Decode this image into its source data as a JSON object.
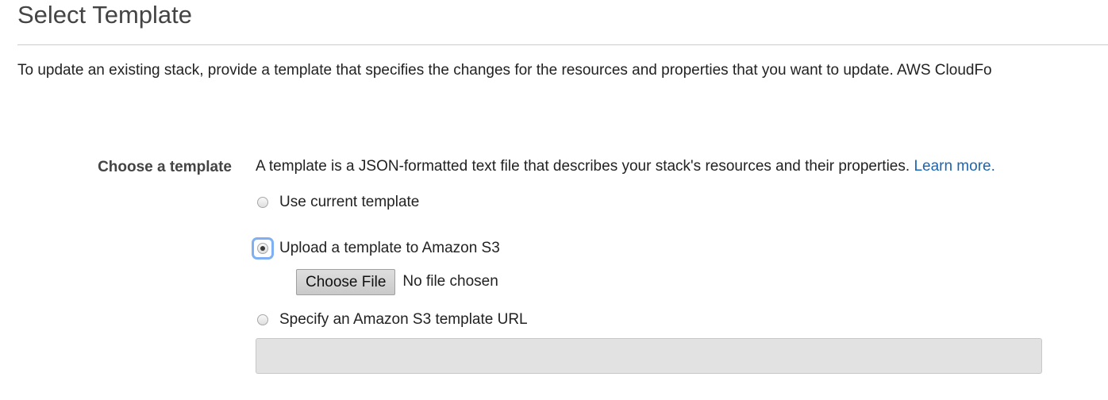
{
  "page": {
    "title": "Select Template",
    "intro": "To update an existing stack, provide a template that specifies the changes for the resources and properties that you want to update. AWS CloudFo"
  },
  "template_field": {
    "label": "Choose a template",
    "description": "A template is a JSON-formatted text file that describes your stack's resources and their properties.",
    "learn_more": "Learn more.",
    "options": [
      {
        "label": "Use current template",
        "selected": false
      },
      {
        "label": "Upload a template to Amazon S3",
        "selected": true
      },
      {
        "label": "Specify an Amazon S3 template URL",
        "selected": false
      }
    ],
    "file_input": {
      "button_label": "Choose File",
      "status": "No file chosen"
    },
    "url_input": {
      "value": "",
      "disabled": true
    }
  },
  "colors": {
    "link": "#1a66b3",
    "focus_ring": "#7fb0f3",
    "disabled_input_bg": "#e2e2e2"
  },
  "icons": [
    "radio-unchecked-icon",
    "radio-checked-icon"
  ]
}
